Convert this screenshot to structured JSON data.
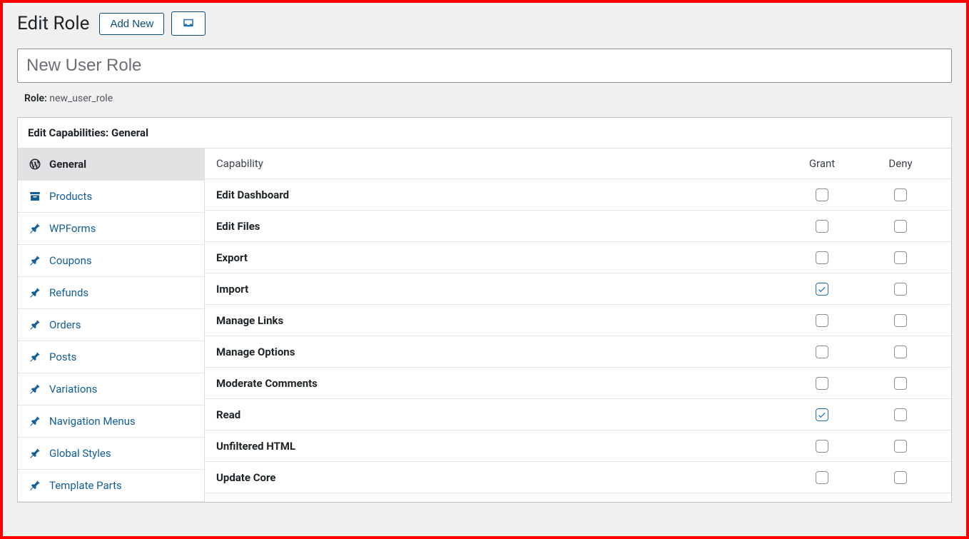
{
  "header": {
    "title": "Edit Role",
    "add_new_label": "Add New"
  },
  "role": {
    "display_name": "New User Role",
    "slug_label": "Role:",
    "slug_value": "new_user_role"
  },
  "panel": {
    "heading": "Edit Capabilities: General"
  },
  "sidebar": {
    "items": [
      {
        "label": "General",
        "icon": "wp",
        "active": true
      },
      {
        "label": "Products",
        "icon": "archive",
        "active": false
      },
      {
        "label": "WPForms",
        "icon": "pin",
        "active": false
      },
      {
        "label": "Coupons",
        "icon": "pin",
        "active": false
      },
      {
        "label": "Refunds",
        "icon": "pin",
        "active": false
      },
      {
        "label": "Orders",
        "icon": "pin",
        "active": false
      },
      {
        "label": "Posts",
        "icon": "pin",
        "active": false
      },
      {
        "label": "Variations",
        "icon": "pin",
        "active": false
      },
      {
        "label": "Navigation Menus",
        "icon": "pin",
        "active": false
      },
      {
        "label": "Global Styles",
        "icon": "pin",
        "active": false
      },
      {
        "label": "Template Parts",
        "icon": "pin",
        "active": false
      }
    ]
  },
  "table": {
    "col_capability": "Capability",
    "col_grant": "Grant",
    "col_deny": "Deny",
    "rows": [
      {
        "label": "Edit Dashboard",
        "grant": false,
        "deny": false
      },
      {
        "label": "Edit Files",
        "grant": false,
        "deny": false
      },
      {
        "label": "Export",
        "grant": false,
        "deny": false
      },
      {
        "label": "Import",
        "grant": true,
        "deny": false
      },
      {
        "label": "Manage Links",
        "grant": false,
        "deny": false
      },
      {
        "label": "Manage Options",
        "grant": false,
        "deny": false
      },
      {
        "label": "Moderate Comments",
        "grant": false,
        "deny": false
      },
      {
        "label": "Read",
        "grant": true,
        "deny": false
      },
      {
        "label": "Unfiltered HTML",
        "grant": false,
        "deny": false
      },
      {
        "label": "Update Core",
        "grant": false,
        "deny": false
      }
    ]
  },
  "icons": {
    "wp": "wordpress-icon",
    "archive": "archive-icon",
    "pin": "pin-icon",
    "inbox": "inbox-icon"
  }
}
